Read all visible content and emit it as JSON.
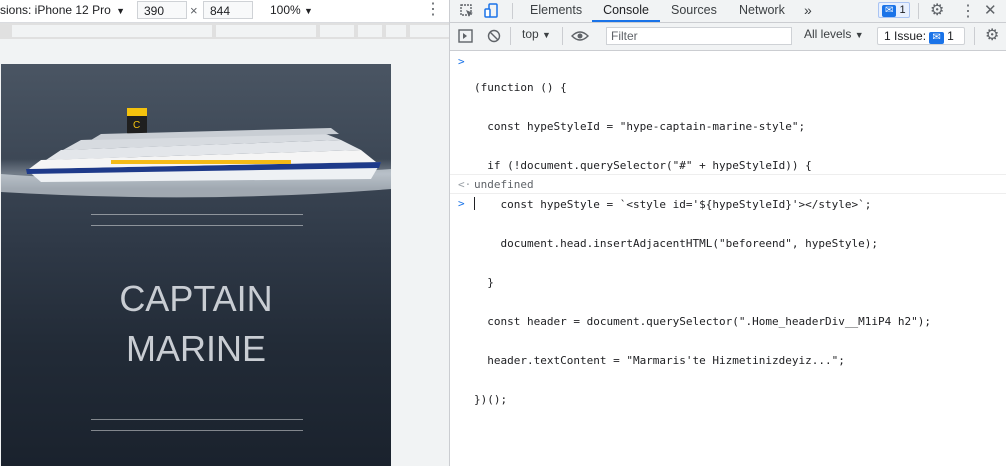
{
  "device_toolbar": {
    "dimensions_label": "sions: iPhone 12 Pro",
    "width": "390",
    "height": "844",
    "zoom": "100%"
  },
  "page": {
    "hero_title_line1": "CAPTAIN",
    "hero_title_line2": "MARINE"
  },
  "devtools": {
    "tabs": [
      "Elements",
      "Console",
      "Sources",
      "Network"
    ],
    "more_tabs": "»",
    "message_count": "1",
    "context": "top",
    "filter_placeholder": "Filter",
    "levels": "All levels",
    "issues": "1 Issue:",
    "issues_count": "1"
  },
  "console": {
    "lines": [
      "(function () {",
      "  const hypeStyleId = \"hype-captain-marine-style\";",
      "  if (!document.querySelector(\"#\" + hypeStyleId)) {",
      "    const hypeStyle = `<style id='${hypeStyleId}'></style>`;",
      "    document.head.insertAdjacentHTML(\"beforeend\", hypeStyle);",
      "  }",
      "  const header = document.querySelector(\".Home_headerDiv__M1iP4 h2\");",
      "  header.textContent = \"Marmaris'te Hizmetinizdeyiz...\";",
      "})();"
    ],
    "result": "undefined"
  }
}
